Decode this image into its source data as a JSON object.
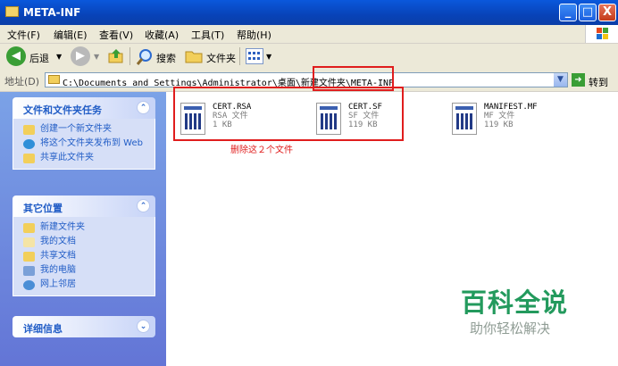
{
  "window": {
    "title": "META-INF",
    "controls": {
      "minimize": "_",
      "maximize": "□",
      "close": "X"
    }
  },
  "menubar": [
    "文件(F)",
    "编辑(E)",
    "查看(V)",
    "收藏(A)",
    "工具(T)",
    "帮助(H)"
  ],
  "toolbar": {
    "back": "后退",
    "forward": "",
    "search": "搜索",
    "folders": "文件夹"
  },
  "address": {
    "label": "地址(D)",
    "path": "C:\\Documents and Settings\\Administrator\\桌面\\新建文件夹\\META-INF",
    "go": "转到"
  },
  "panels": {
    "tasks": {
      "title": "文件和文件夹任务",
      "items": [
        "创建一个新文件夹",
        "将这个文件夹发布到 Web",
        "共享此文件夹"
      ]
    },
    "places": {
      "title": "其它位置",
      "items": [
        "新建文件夹",
        "我的文档",
        "共享文档",
        "我的电脑",
        "网上邻居"
      ]
    },
    "details": {
      "title": "详细信息"
    }
  },
  "files": [
    {
      "name": "CERT.RSA",
      "type": "RSA 文件",
      "size": "1 KB"
    },
    {
      "name": "CERT.SF",
      "type": "SF 文件",
      "size": "119 KB"
    },
    {
      "name": "MANIFEST.MF",
      "type": "MF 文件",
      "size": "119 KB"
    }
  ],
  "annotation": "删除这２个文件",
  "watermark": {
    "title": "百科全说",
    "subtitle": "助你轻松解决"
  },
  "colors": {
    "annotation_red": "#e01d1d",
    "task_link": "#215dc6",
    "watermark_green": "#239a5d"
  }
}
